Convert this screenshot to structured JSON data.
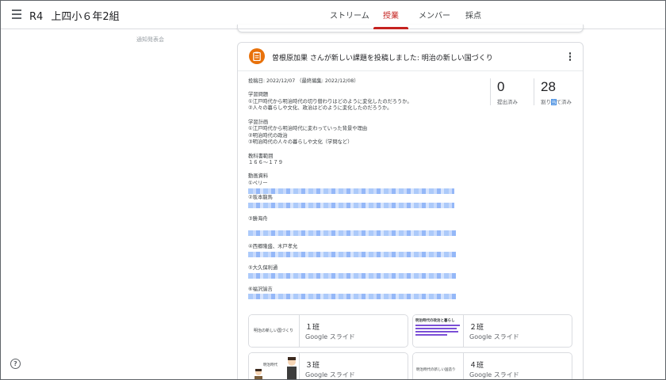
{
  "header": {
    "class_code": "R4",
    "class_name": "上四小６年2組",
    "tabs": [
      {
        "label": "ストリーム"
      },
      {
        "label": "授業"
      },
      {
        "label": "メンバー"
      },
      {
        "label": "採点"
      }
    ],
    "active_tab": "授業"
  },
  "sidebar": {
    "ghost_label": "通知発表会"
  },
  "post": {
    "title": "曽根原加果 さんが新しい課題を投稿しました: 明治の新しい国づくり",
    "posted": "投稿日: 2022/12/07 （最終編集: 2022/12/08）",
    "body_lines": [
      "学習問題",
      "①江戸時代から明治時代の切り替わりはどのように変化したのだろうか。",
      "②人々の暮らしや文化、政治はどのように変化したのだろうか。",
      "",
      "学習計画",
      "①江戸時代から明治時代に変わっていった背景や理由",
      "②明治時代の政治",
      "③明治時代の人々の暮らしや文化（学問など）",
      "",
      "教科書範囲",
      "１６６～１７９",
      "",
      "動画資料",
      "①ペリー"
    ],
    "video_items": [
      "②坂本龍馬",
      "③勝海舟",
      "④西郷隆盛、木戸孝允",
      "⑤大久保利通",
      "⑥福沢諭吉"
    ],
    "stats": {
      "turned_in_count": "0",
      "turned_in_label": "提出済み",
      "assigned_count": "28",
      "assigned_label_pre": "割り",
      "assigned_label_hl": "当",
      "assigned_label_post": "て済み"
    },
    "attachments": [
      {
        "thumb_text": "明治の新しい国づくり",
        "title": "１班",
        "type": "Google スライド"
      },
      {
        "thumb_text": "明治時代の政治と暮らし",
        "title": "２班",
        "type": "Google スライド"
      },
      {
        "thumb_text": "明治時代",
        "title": "３班",
        "type": "Google スライド"
      },
      {
        "thumb_text": "明治時代の新しい国造り",
        "title": "４班",
        "type": "Google スライド"
      }
    ]
  },
  "colors": {
    "accent": "#c5221f",
    "assignment_icon": "#e8710a"
  },
  "icons": {
    "menu": "menu-icon",
    "assignment": "assignment-icon",
    "more": "more-vert-icon",
    "help": "help-icon"
  },
  "help_label": "?"
}
